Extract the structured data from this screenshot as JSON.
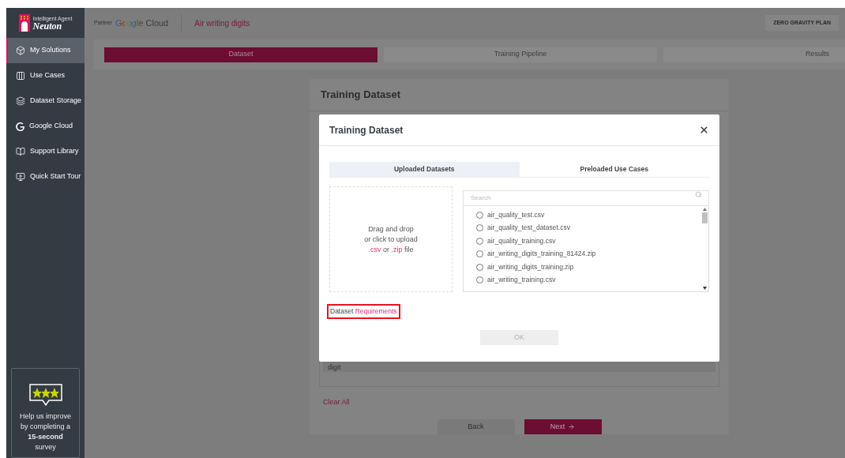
{
  "sidebar": {
    "logo": {
      "tagline": "Intelligent Agent",
      "name": "Neuton"
    },
    "items": [
      {
        "kind": "box",
        "label": "My Solutions",
        "selected": true
      },
      {
        "kind": "columns",
        "label": "Use Cases",
        "selected": false
      },
      {
        "kind": "layers",
        "label": "Dataset Storage",
        "selected": false
      },
      {
        "kind": "google",
        "label": "Google Cloud",
        "selected": false
      },
      {
        "kind": "book",
        "label": "Support Library",
        "selected": false
      },
      {
        "kind": "tour",
        "label": "Quick Start Tour",
        "selected": false
      }
    ],
    "survey": {
      "text": "Help us improve by completing a **15-second** survey"
    }
  },
  "header": {
    "partner_label": "Partner",
    "partner_name": "Google Cloud",
    "project": "Air writing digits",
    "plan": "ZERO GRAVITY PLAN"
  },
  "steps": [
    {
      "label": "Dataset",
      "selected": true
    },
    {
      "label": "Training Pipeline",
      "selected": false
    },
    {
      "label": "Results",
      "selected": false
    }
  ],
  "page": {
    "title": "Training Dataset",
    "row_label": "digit",
    "clear_all": "Clear All",
    "back": "Back",
    "next": "Next"
  },
  "dialog": {
    "title": "Training Dataset",
    "tabs": [
      {
        "label": "Uploaded Datasets",
        "selected": true
      },
      {
        "label": "Preloaded Use Cases",
        "selected": false
      }
    ],
    "dropzone": {
      "line_1": "Drag and drop",
      "line_2": "or click to upload",
      "ext_1": ".csv",
      "joiner": "or",
      "ext_2": ".zip",
      "suffix": "file"
    },
    "search": {
      "placeholder": "Search"
    },
    "files": [
      {
        "name": "air_quality_test.csv",
        "selected": false
      },
      {
        "name": "air_quality_test_dataset.csv",
        "selected": false
      },
      {
        "name": "air_quality_training.csv",
        "selected": false
      },
      {
        "name": "air_writing_digits_training_81424.zip",
        "selected": false
      },
      {
        "name": "air_writing_digits_training.zip",
        "selected": false
      },
      {
        "name": "air_writing_training.csv",
        "selected": false
      }
    ],
    "requirements": {
      "prefix": "Dataset",
      "link": "Requirements",
      "highlighted": true
    },
    "ok": {
      "label": "OK",
      "disabled": true
    }
  }
}
